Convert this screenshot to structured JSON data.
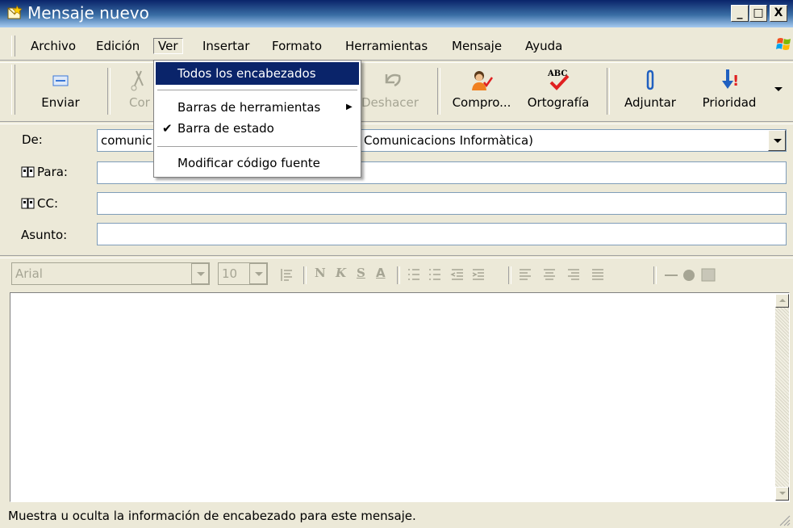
{
  "window": {
    "title": "Mensaje nuevo",
    "minimize": "_",
    "maximize": "□",
    "close": "X"
  },
  "menubar": {
    "items": [
      {
        "label": "Archivo"
      },
      {
        "label": "Edición"
      },
      {
        "label": "Ver"
      },
      {
        "label": "Insertar"
      },
      {
        "label": "Formato"
      },
      {
        "label": "Herramientas"
      },
      {
        "label": "Mensaje"
      },
      {
        "label": "Ayuda"
      }
    ],
    "active": "Ver"
  },
  "toolbar": {
    "buttons": [
      {
        "label": "Enviar",
        "icon": "send-icon",
        "enabled": true
      },
      {
        "label": "Cor",
        "icon": "cut-icon",
        "enabled": false
      },
      {
        "label": "Deshacer",
        "icon": "undo-icon",
        "enabled": false
      },
      {
        "label": "Compro...",
        "icon": "check-names-icon",
        "enabled": true
      },
      {
        "label": "Ortografía",
        "icon": "spelling-icon",
        "enabled": true
      },
      {
        "label": "Adjuntar",
        "icon": "paperclip-icon",
        "enabled": true
      },
      {
        "label": "Prioridad",
        "icon": "priority-icon",
        "enabled": true
      }
    ],
    "spelling_icon_text": "ABC",
    "priority_icon_text": "!"
  },
  "view_menu": {
    "items": [
      {
        "label": "Todos los encabezados",
        "highlighted": true,
        "checked": false,
        "submenu": false
      },
      {
        "label": "Barras de herramientas",
        "highlighted": false,
        "checked": false,
        "submenu": true
      },
      {
        "label": "Barra de estado",
        "highlighted": false,
        "checked": true,
        "submenu": false
      },
      {
        "label": "Modificar código fuente",
        "highlighted": false,
        "checked": false,
        "submenu": false
      }
    ],
    "check_mark": "✔",
    "submenu_arrow": "▶"
  },
  "headers": {
    "from_label": "De:",
    "from_value_left": "comunic",
    "from_value_right": "Comunicacions Informàtica)",
    "to_label": "Para:",
    "to_value": "",
    "cc_label": "CC:",
    "cc_value": "",
    "subject_label": "Asunto:",
    "subject_value": ""
  },
  "format_bar": {
    "font": "Arial",
    "size": "10",
    "bold": "N",
    "italic": "K",
    "underline": "S",
    "font_color": "A",
    "enabled": false
  },
  "body": {
    "text": ""
  },
  "status_bar": {
    "text": "Muestra u oculta la información de encabezado para este mensaje."
  },
  "colors": {
    "title_bar": "#0a246a",
    "menu_highlight": "#0a246a",
    "chrome": "#ece9d8",
    "send_blue": "#3a78d8",
    "priority_red": "#e02020"
  }
}
